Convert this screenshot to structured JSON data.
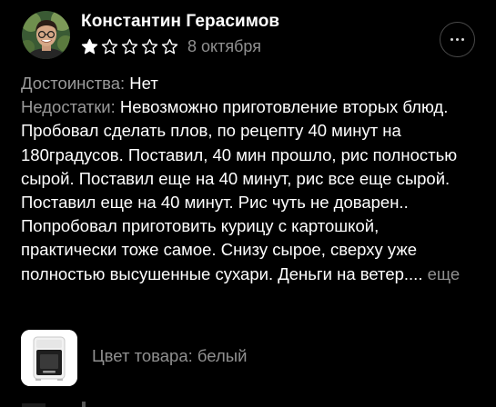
{
  "review": {
    "author_name": "Константин Герасимов",
    "rating": {
      "value": 1,
      "max": 5
    },
    "date": "8 октября",
    "pros_label": "Достоинства:",
    "pros_text": "Нет",
    "cons_label": "Недостатки:",
    "cons_text": "Невозможно приготовление вторых блюд. Пробовал сделать плов, по рецепту 40 минут на 180градусов. Поставил, 40 мин прошло, рис полностью сырой. Поставил еще на 40 минут, рис все еще сырой. Поставил еще на 40 минут. Рис чуть не доварен.. Попробовал приготовить курицу с картошкой, практически тоже самое. Снизу сырое, сверху уже полностью высушенные сухари. Деньги на ветер....",
    "more_label": "еще",
    "product_color": "Цвет товара: белый"
  },
  "icons": {
    "avatar": "user-photo",
    "star_filled": "star-filled-icon",
    "star_empty": "star-outline-icon",
    "more": "more-horizontal-icon",
    "product": "air-fryer-product-photo"
  },
  "colors": {
    "background": "#000000",
    "text_primary": "#ffffff",
    "text_secondary": "#909090",
    "label": "#9a9a9a",
    "star": "#ffffff"
  }
}
